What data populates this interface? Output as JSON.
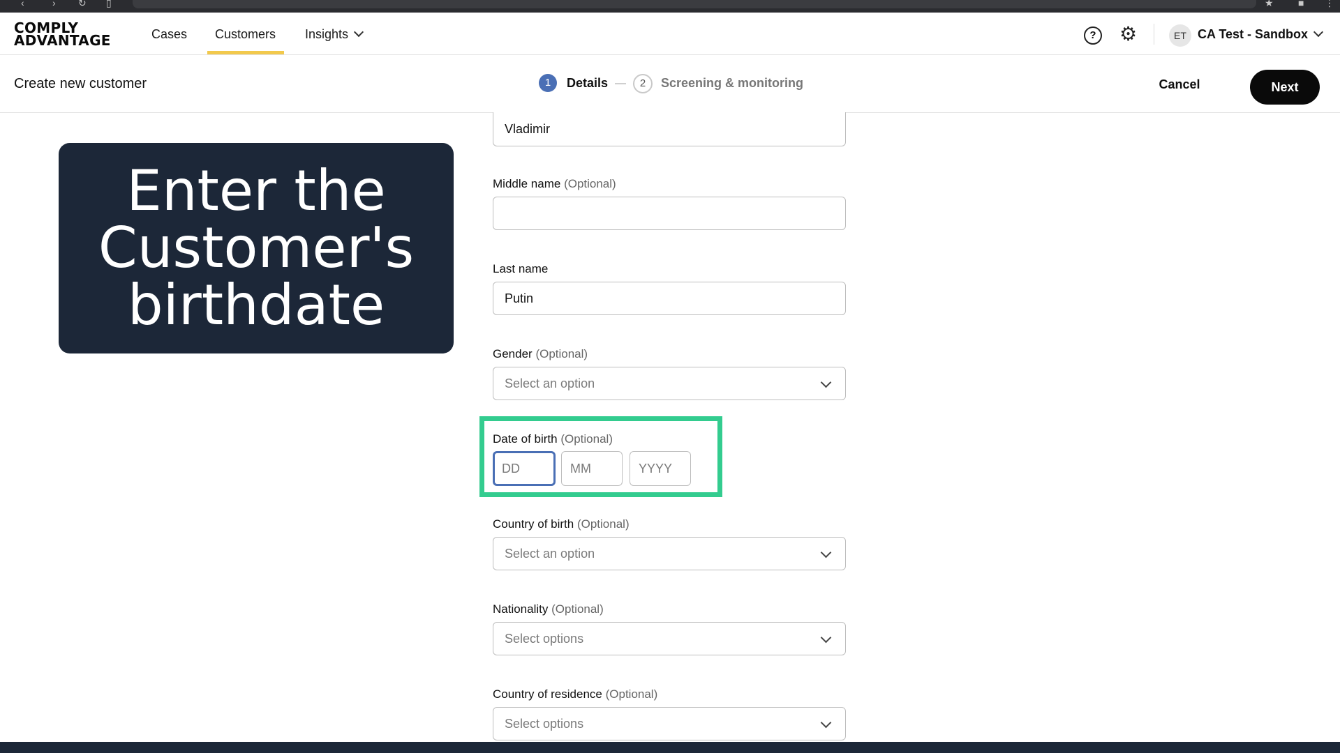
{
  "nav": {
    "logo_line1": "COMPLY",
    "logo_line2": "ADVANTAGE",
    "links": [
      "Cases",
      "Customers",
      "Insights"
    ],
    "active_link": "Customers",
    "help_icon": "help-icon",
    "settings_icon": "gear-icon",
    "avatar_initials": "ET",
    "account_name": "CA Test - Sandbox"
  },
  "subheader": {
    "title": "Create new customer",
    "steps": [
      {
        "num": "1",
        "label": "Details",
        "state": "active"
      },
      {
        "num": "2",
        "label": "Screening & monitoring",
        "state": "inactive"
      }
    ],
    "cancel_label": "Cancel",
    "next_label": "Next"
  },
  "callout": {
    "text": "Enter the\nCustomer's\nbirthdate"
  },
  "form": {
    "first_name_value": "Vladimir",
    "middle_name": {
      "label": "Middle name",
      "optional": "(Optional)",
      "value": ""
    },
    "last_name": {
      "label": "Last name",
      "value": "Putin"
    },
    "gender": {
      "label": "Gender",
      "optional": "(Optional)",
      "placeholder": "Select an option"
    },
    "dob": {
      "label": "Date of birth",
      "optional": "(Optional)",
      "day_placeholder": "DD",
      "month_placeholder": "MM",
      "year_placeholder": "YYYY"
    },
    "country_of_birth": {
      "label": "Country of birth",
      "optional": "(Optional)",
      "placeholder": "Select an option"
    },
    "nationality": {
      "label": "Nationality",
      "optional": "(Optional)",
      "placeholder": "Select options"
    },
    "country_of_residence": {
      "label": "Country of residence",
      "optional": "(Optional)",
      "placeholder": "Select options"
    }
  },
  "colors": {
    "accent_underline": "#f2c94c",
    "step_active": "#4a6fb5",
    "highlight": "#33cc8f",
    "callout_bg": "#1c2738"
  }
}
